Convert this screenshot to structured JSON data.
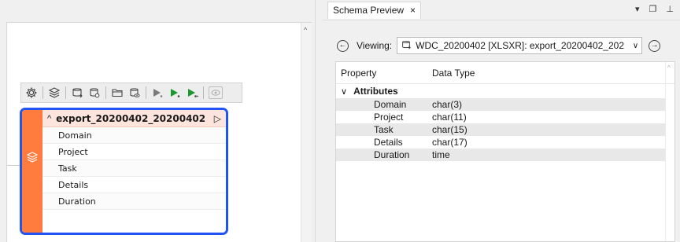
{
  "schema_preview": {
    "tab_label": "Schema Preview",
    "tab_close": "×",
    "tool_dropdown": "▾",
    "tool_float": "❐",
    "tool_pin": "⊥",
    "viewing_label": "Viewing:",
    "viewing_value": "WDC_20200402 [XLSXR]: export_20200402_202",
    "columns": [
      "Property",
      "Data Type"
    ],
    "group_label": "Attributes",
    "rows": [
      {
        "property": "Domain",
        "type": "char(3)"
      },
      {
        "property": "Project",
        "type": "char(11)"
      },
      {
        "property": "Task",
        "type": "char(15)"
      },
      {
        "property": "Details",
        "type": "char(17)"
      },
      {
        "property": "Duration",
        "type": "time"
      }
    ]
  },
  "feature_type": {
    "title": "export_20200402_20200402",
    "attributes": [
      "Domain",
      "Project",
      "Task",
      "Details",
      "Duration"
    ]
  },
  "colors": {
    "accent_blue": "#2254f4",
    "stripe_orange": "#ff7b3e",
    "header_pink": "#fde4dc",
    "run_green": "#1a9a2c"
  },
  "icons": [
    "gear-icon",
    "layers-icon",
    "reader-add-icon",
    "reader-settings-icon",
    "folder-icon",
    "inspect-icon",
    "run-to-icon",
    "run-from-icon",
    "run-icon",
    "eye-icon"
  ]
}
